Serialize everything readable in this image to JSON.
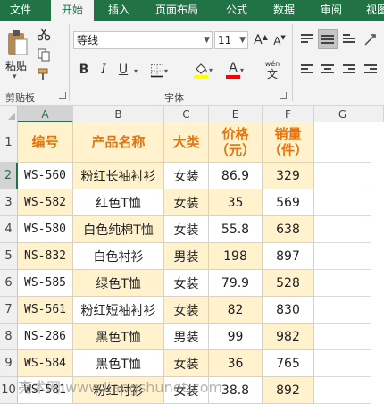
{
  "ribbon": {
    "tabs": [
      {
        "label": "文件",
        "active": false
      },
      {
        "label": "开始",
        "active": true
      },
      {
        "label": "插入",
        "active": false
      },
      {
        "label": "页面布局",
        "active": false
      },
      {
        "label": "公式",
        "active": false
      },
      {
        "label": "数据",
        "active": false
      },
      {
        "label": "审阅",
        "active": false
      },
      {
        "label": "视图",
        "active": false
      }
    ],
    "clipboard": {
      "paste_label": "粘贴",
      "group_label": "剪贴板"
    },
    "font": {
      "name": "等线",
      "size": "11",
      "group_label": "字体",
      "bold": "B",
      "italic": "I",
      "underline": "U",
      "grow": "A",
      "shrink": "A",
      "font_color_glyph": "A",
      "fill_color": "#ffff00",
      "font_color": "#ff0000",
      "phonetic_top": "wén",
      "phonetic_bottom": "文"
    }
  },
  "sheet": {
    "columns": [
      "A",
      "B",
      "C",
      "E",
      "F",
      "G"
    ],
    "rows": [
      "1",
      "2",
      "3",
      "4",
      "5",
      "6",
      "7",
      "8",
      "9",
      "10"
    ],
    "selected_column": "A",
    "selected_row": "2",
    "header": {
      "code": "编号",
      "name": "产品名称",
      "category": "大类",
      "price_line1": "价格",
      "price_line2": "（元）",
      "sales_line1": "销量",
      "sales_line2": "（件）"
    },
    "data": [
      {
        "code": "WS-560",
        "name": "粉红长袖衬衫",
        "category": "女装",
        "price": "86.9",
        "sales": "329"
      },
      {
        "code": "WS-582",
        "name": "红色T恤",
        "category": "女装",
        "price": "35",
        "sales": "569"
      },
      {
        "code": "WS-580",
        "name": "白色纯棉T恤",
        "category": "女装",
        "price": "55.8",
        "sales": "638"
      },
      {
        "code": "NS-832",
        "name": "白色衬衫",
        "category": "男装",
        "price": "198",
        "sales": "897"
      },
      {
        "code": "WS-585",
        "name": "绿色T恤",
        "category": "女装",
        "price": "79.9",
        "sales": "528"
      },
      {
        "code": "WS-561",
        "name": "粉红短袖衬衫",
        "category": "女装",
        "price": "82",
        "sales": "830"
      },
      {
        "code": "NS-286",
        "name": "黑色T恤",
        "category": "男装",
        "price": "99",
        "sales": "982"
      },
      {
        "code": "WS-584",
        "name": "黑色T恤",
        "category": "女装",
        "price": "36",
        "sales": "765"
      },
      {
        "code": "WS-581",
        "name": "粉红衬衫",
        "category": "女装",
        "price": "38.8",
        "sales": "892"
      }
    ],
    "shade_color": "#fff2cc",
    "header_text_color": "#e8720c"
  },
  "watermark": {
    "text": "亮术网 www.liangshunet.com"
  },
  "colors": {
    "accent": "#217346"
  }
}
